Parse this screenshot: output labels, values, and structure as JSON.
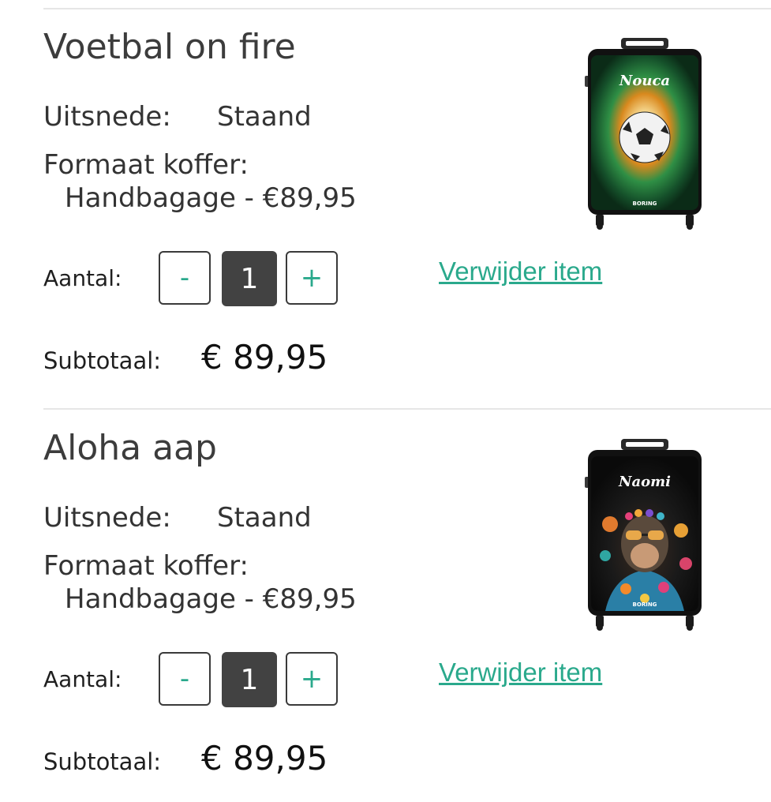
{
  "labels": {
    "cut": "Uitsnede:",
    "format": "Formaat koffer:",
    "quantity": "Aantal:",
    "minus": "-",
    "plus": "+",
    "remove": "Verwijder item",
    "subtotal": "Subtotaal:"
  },
  "items": [
    {
      "title": "Voetbal on fire",
      "cut": "Staand",
      "format": "Handbagage - €89,95",
      "quantity": "1",
      "subtotal": "€ 89,95",
      "suitcase_name": "Nouca",
      "brand": "BORING"
    },
    {
      "title": "Aloha aap",
      "cut": "Staand",
      "format": "Handbagage - €89,95",
      "quantity": "1",
      "subtotal": "€ 89,95",
      "suitcase_name": "Naomi",
      "brand": "BORING"
    }
  ],
  "colors": {
    "accent": "#2aa98c",
    "dark": "#424242",
    "divider": "#e6e6e6"
  }
}
